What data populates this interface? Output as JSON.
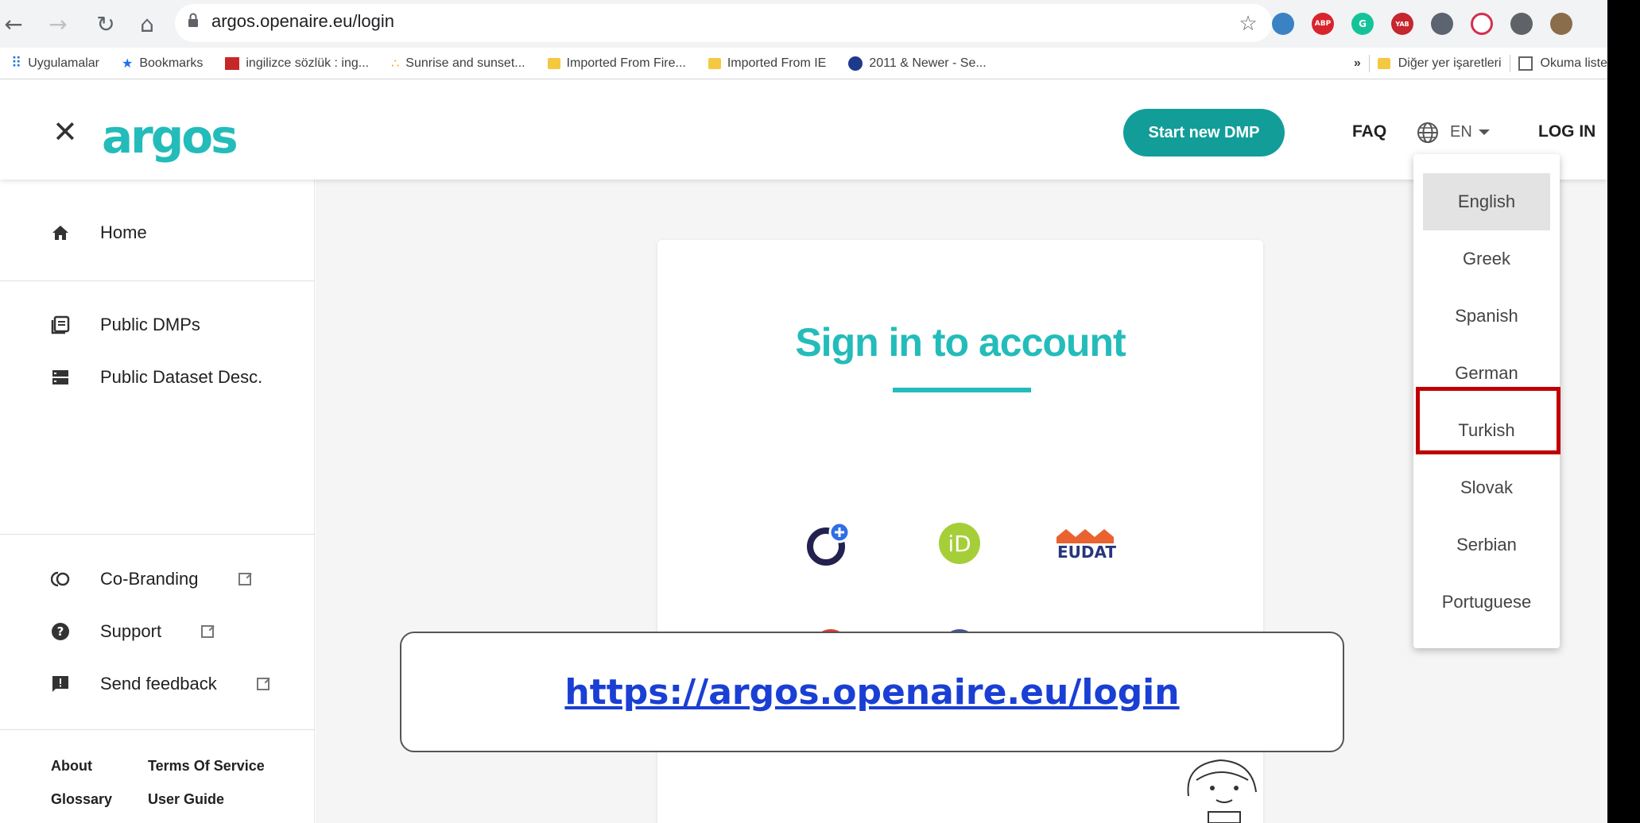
{
  "browser": {
    "url": "argos.openaire.eu/login",
    "bookmarks": [
      {
        "label": "Uygulamalar"
      },
      {
        "label": "Bookmarks"
      },
      {
        "label": "ingilizce sözlük : ing..."
      },
      {
        "label": "Sunrise and sunset..."
      },
      {
        "label": "Imported From Fire..."
      },
      {
        "label": "Imported From IE"
      },
      {
        "label": "2011 & Newer - Se..."
      }
    ],
    "bookmarks_overflow": "»",
    "other_bookmarks": "Diğer yer işaretleri",
    "reading_list": "Okuma liste"
  },
  "header": {
    "logo": "argos",
    "start_button": "Start new DMP",
    "faq": "FAQ",
    "language": "EN",
    "login": "LOG IN"
  },
  "sidebar": {
    "items": [
      {
        "label": "Home",
        "icon": "home-icon"
      },
      {
        "label": "Public DMPs",
        "icon": "list-icon"
      },
      {
        "label": "Public Dataset Desc.",
        "icon": "dataset-icon"
      },
      {
        "label": "Co-Branding",
        "icon": "cobranding-icon"
      },
      {
        "label": "Support",
        "icon": "help-icon"
      },
      {
        "label": "Send feedback",
        "icon": "feedback-icon"
      }
    ],
    "footer": {
      "about": "About",
      "terms": "Terms Of Service",
      "glossary": "Glossary",
      "guide": "User Guide"
    }
  },
  "main": {
    "title": "Sign in to account",
    "providers": [
      "openaire",
      "orcid",
      "EUDAT"
    ]
  },
  "language_menu": {
    "options": [
      "English",
      "Greek",
      "Spanish",
      "German",
      "Turkish",
      "Slovak",
      "Serbian",
      "Portuguese"
    ],
    "selected": "English",
    "highlighted": "Turkish"
  },
  "overlay": {
    "url": "https://argos.openaire.eu/login"
  },
  "colors": {
    "brand": "#23bcba",
    "button": "#129d99",
    "highlight": "#c00000",
    "link": "#1a3fd4"
  }
}
